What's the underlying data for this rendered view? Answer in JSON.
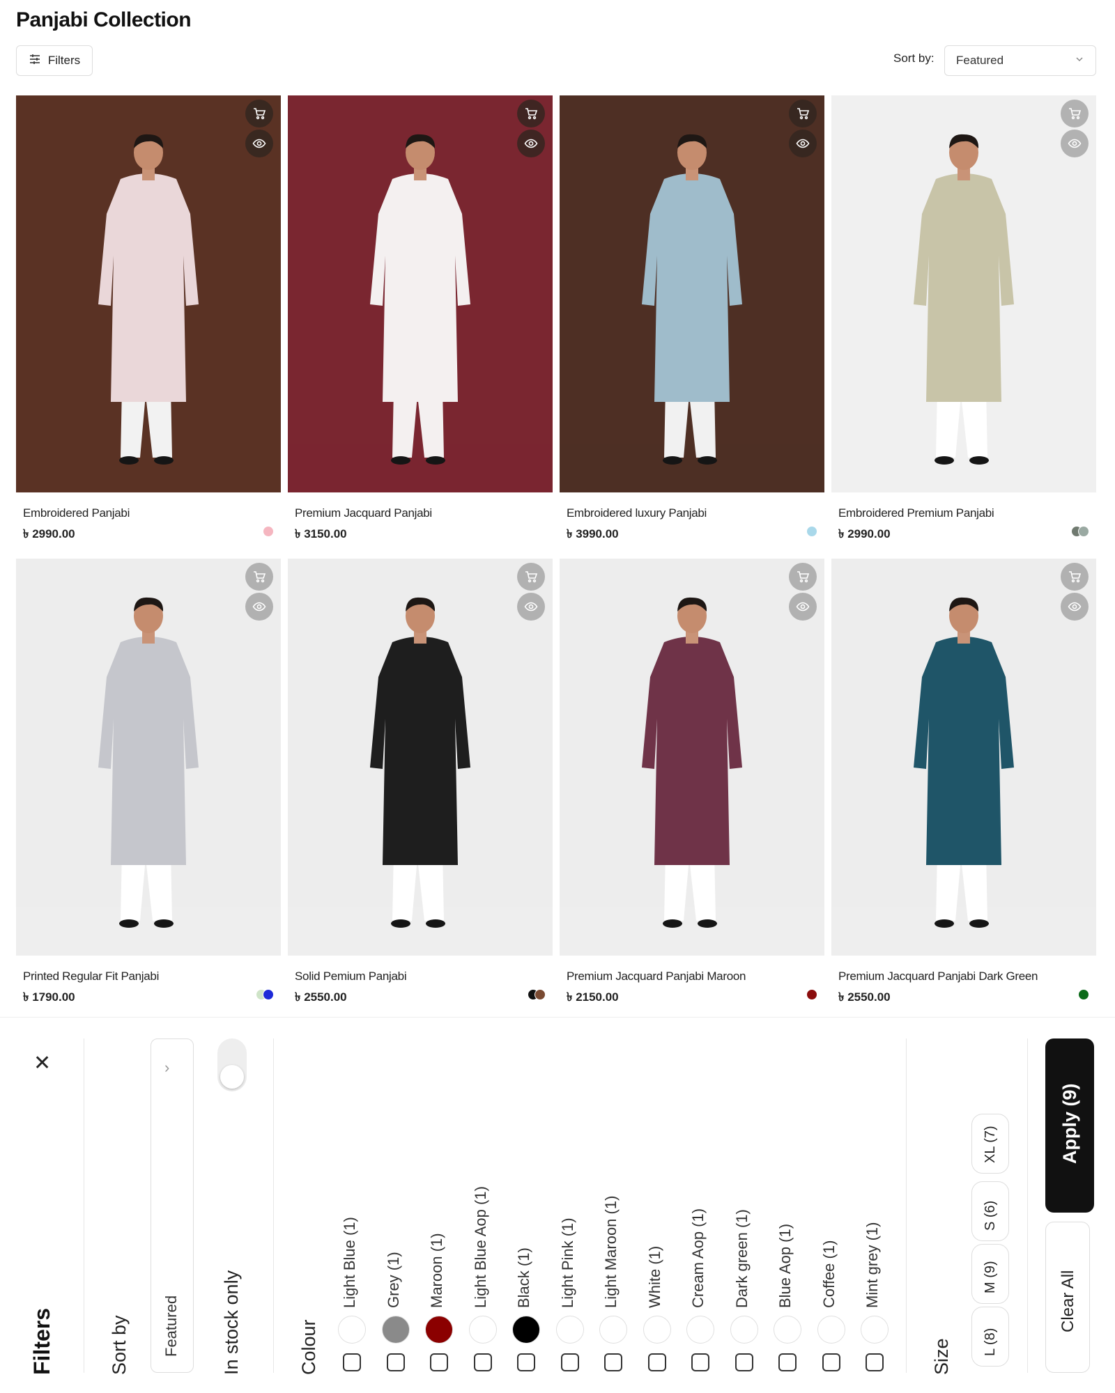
{
  "page": {
    "title": "Panjabi Collection"
  },
  "toolbar": {
    "filters_label": "Filters",
    "sort_label": "Sort by:",
    "sort_value": "Featured"
  },
  "products": [
    {
      "name": "Embroidered Panjabi",
      "price": "৳ 2990.00",
      "swatches": [
        "#f5b6c0"
      ],
      "bg": "#5a3224",
      "kurta": "#ead7d9",
      "pants": "#f2f2f2",
      "button_style": "dark"
    },
    {
      "name": "Premium Jacquard Panjabi",
      "price": "৳ 3150.00",
      "swatches": [],
      "bg": "#7a2630",
      "kurta": "#f4f0f0",
      "pants": "#f4f0f0",
      "button_style": "dark"
    },
    {
      "name": "Embroidered luxury Panjabi",
      "price": "৳ 3990.00",
      "swatches": [
        "#a9d8ea"
      ],
      "bg": "#4e2f24",
      "kurta": "#9fbccb",
      "pants": "#f1f1f1",
      "button_style": "dark"
    },
    {
      "name": "Embroidered Premium Panjabi",
      "price": "৳ 2990.00",
      "swatches": [
        "#707a70",
        "#9aa9a2"
      ],
      "bg": "#f0f0f0",
      "kurta": "#c8c4a8",
      "pants": "#ffffff",
      "button_style": "light"
    },
    {
      "name": "Printed Regular Fit Panjabi",
      "price": "৳ 1790.00",
      "swatches": [
        "#cfe4c8",
        "#1d2ad8"
      ],
      "bg": "#ededed",
      "kurta": "#c5c6cc",
      "pants": "#ffffff",
      "button_style": "light"
    },
    {
      "name": "Solid Pemium Panjabi",
      "price": "৳ 2550.00",
      "swatches": [
        "#111111",
        "#7a4a32"
      ],
      "bg": "#ededed",
      "kurta": "#1e1e1e",
      "pants": "#ffffff",
      "button_style": "light"
    },
    {
      "name": "Premium Jacquard Panjabi Maroon",
      "price": "৳ 2150.00",
      "swatches": [
        "#8b0d0d"
      ],
      "bg": "#ededed",
      "kurta": "#6f3348",
      "pants": "#ffffff",
      "button_style": "light"
    },
    {
      "name": "Premium Jacquard Panjabi Dark Green",
      "price": "৳ 2550.00",
      "swatches": [
        "#0c6b1a"
      ],
      "bg": "#ededed",
      "kurta": "#1f5568",
      "pants": "#ffffff",
      "button_style": "light"
    }
  ],
  "filter_panel": {
    "title": "Filters",
    "close_icon": "close-icon",
    "sort_section_title": "Sort by",
    "sort_value": "Featured",
    "in_stock_label": "In stock only",
    "in_stock_enabled": false,
    "colour_title": "Colour",
    "colours": [
      {
        "label": "Light Blue (1)",
        "color": "#ffffff"
      },
      {
        "label": "Grey (1)",
        "color": "#8a8a8a"
      },
      {
        "label": "Maroon (1)",
        "color": "#8b0000"
      },
      {
        "label": "Light Blue Aop (1)",
        "color": "#ffffff"
      },
      {
        "label": "Black (1)",
        "color": "#000000"
      },
      {
        "label": "Light Pink (1)",
        "color": "#ffffff"
      },
      {
        "label": "Light Maroon (1)",
        "color": "#ffffff"
      },
      {
        "label": "White (1)",
        "color": "#ffffff"
      },
      {
        "label": "Cream Aop (1)",
        "color": "#ffffff"
      },
      {
        "label": "Dark green (1)",
        "color": "#ffffff"
      },
      {
        "label": "Blue Aop (1)",
        "color": "#ffffff"
      },
      {
        "label": "Coffee (1)",
        "color": "#ffffff"
      },
      {
        "label": "Mint grey (1)",
        "color": "#ffffff"
      }
    ],
    "size_title": "Size",
    "sizes": [
      "L (8)",
      "M (9)",
      "S (6)",
      "XL (7)"
    ],
    "apply_label": "Apply (9)",
    "clear_label": "Clear All"
  },
  "colors": {
    "accent": "#111111",
    "border": "#dddddd"
  }
}
